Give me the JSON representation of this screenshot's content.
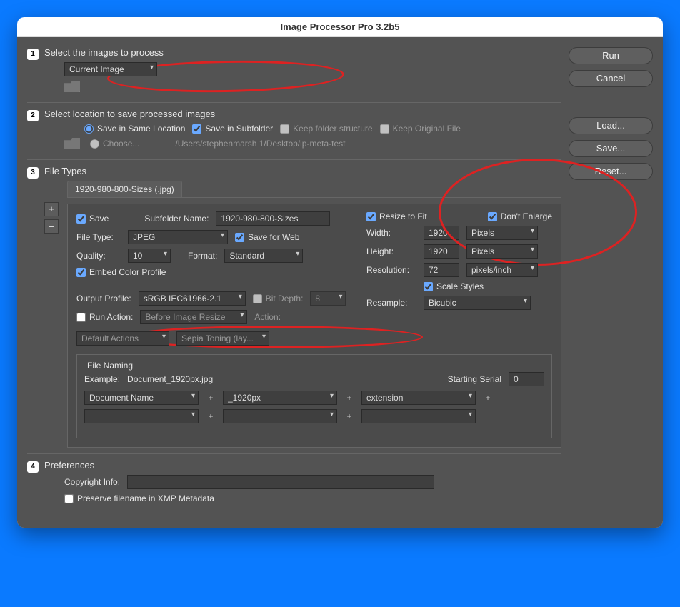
{
  "window": {
    "title": "Image Processor Pro 3.2b5"
  },
  "buttons": {
    "run": "Run",
    "cancel": "Cancel",
    "load": "Load...",
    "save": "Save...",
    "reset": "Reset..."
  },
  "step1": {
    "num": "1",
    "title": "Select the images to process",
    "source": "Current Image"
  },
  "step2": {
    "num": "2",
    "title": "Select location to save processed images",
    "same_loc": "Save in Same Location",
    "subfolder": "Save in Subfolder",
    "keep_struct": "Keep folder structure",
    "keep_orig": "Keep Original File",
    "choose": "Choose...",
    "path": "/Users/stephenmarsh 1/Desktop/ip-meta-test"
  },
  "step3": {
    "num": "3",
    "title": "File Types",
    "tab": "1920-980-800-Sizes (.jpg)",
    "save_label": "Save",
    "subfolder_label": "Subfolder Name:",
    "subfolder_value": "1920-980-800-Sizes",
    "filetype_label": "File Type:",
    "filetype": "JPEG",
    "save_for_web": "Save for Web",
    "quality_label": "Quality:",
    "quality": "10",
    "format_label": "Format:",
    "format": "Standard",
    "embed_profile": "Embed Color Profile",
    "output_profile_label": "Output Profile:",
    "output_profile": "sRGB IEC61966-2.1",
    "bit_depth_label": "Bit Depth:",
    "bit_depth": "8",
    "run_action_label": "Run Action:",
    "run_action_when": "Before Image Resize",
    "action_label": "Action:",
    "action_set": "Default Actions",
    "action_name": "Sepia Toning (lay...",
    "resize_fit": "Resize to Fit",
    "dont_enlarge": "Don't Enlarge",
    "width_label": "Width:",
    "width": "1920",
    "width_unit": "Pixels",
    "height_label": "Height:",
    "height": "1920",
    "height_unit": "Pixels",
    "res_label": "Resolution:",
    "resolution": "72",
    "res_unit": "pixels/inch",
    "scale_styles": "Scale Styles",
    "resample_label": "Resample:",
    "resample": "Bicubic",
    "naming": {
      "legend": "File Naming",
      "example_label": "Example:",
      "example": "Document_1920px.jpg",
      "serial_label": "Starting Serial",
      "serial": "0",
      "slot1": "Document Name",
      "slot2": "_1920px",
      "slot3": "extension",
      "slot4": "",
      "slot5": "",
      "slot6": ""
    }
  },
  "step4": {
    "num": "4",
    "title": "Preferences",
    "copyright_label": "Copyright Info:",
    "copyright": "",
    "preserve_xmp": "Preserve filename in XMP Metadata"
  }
}
